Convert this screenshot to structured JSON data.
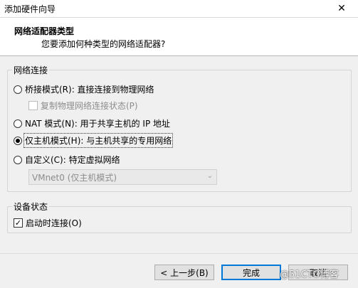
{
  "window": {
    "title": "添加硬件向导",
    "close_glyph": "✕"
  },
  "header": {
    "title": "网络适配器类型",
    "subtitle": "您要添加何种类型的网络适配器?"
  },
  "network": {
    "legend": "网络连接",
    "bridged_label": "桥接模式(R): 直接连接到物理网络",
    "replicate_label": "复制物理网络连接状态(P)",
    "nat_label": "NAT 模式(N): 用于共享主机的 IP 地址",
    "hostonly_label": "仅主机模式(H): 与主机共享的专用网络",
    "custom_label": "自定义(C): 特定虚拟网络",
    "vmnet_selected": "VMnet0 (仅主机模式)",
    "selected": "hostonly"
  },
  "device_status": {
    "legend": "设备状态",
    "connect_on_start_label": "启动时连接(O)",
    "connect_on_start_checked": true
  },
  "buttons": {
    "back_label": "< 上一步(B)",
    "finish_label": "完成",
    "cancel_label": "取消"
  },
  "watermark": "@51CTO博客"
}
